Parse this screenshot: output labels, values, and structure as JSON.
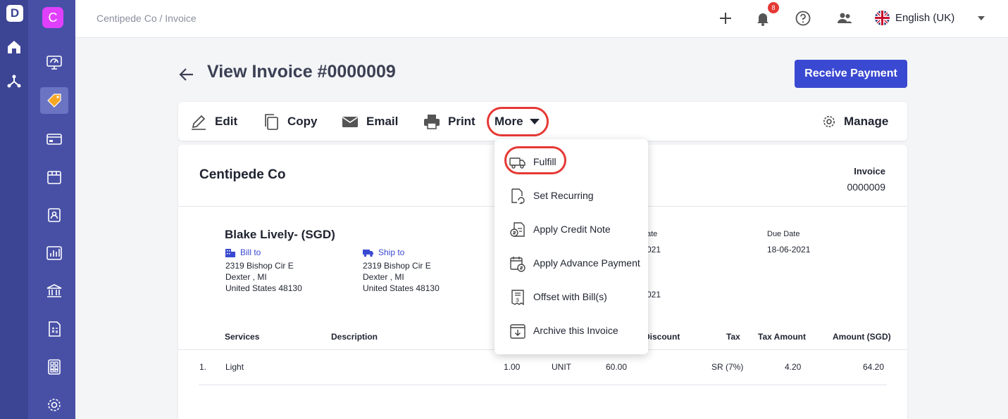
{
  "app": {
    "logo_letter": "D",
    "org_letter": "C"
  },
  "topbar": {
    "breadcrumb": "Centipede Co / Invoice",
    "notification_count": "8",
    "language": "English (UK)"
  },
  "page": {
    "title": "View Invoice #0000009",
    "receive_payment": "Receive Payment"
  },
  "toolbar": {
    "edit": "Edit",
    "copy": "Copy",
    "email": "Email",
    "print": "Print",
    "more": "More",
    "manage": "Manage"
  },
  "menu": {
    "items": [
      {
        "label": "Fulfill",
        "icon": "truck-icon"
      },
      {
        "label": "Set Recurring",
        "icon": "recurring-doc-icon"
      },
      {
        "label": "Apply Credit Note",
        "icon": "credit-note-icon"
      },
      {
        "label": "Apply Advance Payment",
        "icon": "advance-payment-icon"
      },
      {
        "label": "Offset with Bill(s)",
        "icon": "offset-bill-icon"
      },
      {
        "label": "Archive this Invoice",
        "icon": "archive-icon"
      }
    ]
  },
  "invoice": {
    "company": "Centipede Co",
    "label": "Invoice",
    "number": "0000009",
    "customer": "Blake Lively- (SGD)",
    "bill_to": {
      "heading": "Bill to",
      "line1": "2319 Bishop Cir E",
      "line2": "Dexter , MI",
      "line3": "United States 48130"
    },
    "ship_to": {
      "heading": "Ship to",
      "line1": "2319 Bishop Cir E",
      "line2": "Dexter , MI",
      "line3": "United States 48130"
    },
    "invoice_date_label_partial": "ate",
    "invoice_date_partial": "021",
    "extra_date_partial": "021",
    "due_date_label": "Due Date",
    "due_date": "18-06-2021",
    "columns": {
      "services": "Services",
      "description": "Description",
      "discount_partial": "Discount",
      "tax": "Tax",
      "tax_amount": "Tax Amount",
      "amount": "Amount (SGD)"
    },
    "rows": [
      {
        "index": "1.",
        "service": "Light",
        "qty": "1.00",
        "unit": "UNIT",
        "price": "60.00",
        "tax": "SR (7%)",
        "tax_amount": "4.20",
        "amount": "64.20"
      }
    ]
  },
  "colors": {
    "primary": "#3a49d1",
    "rail": "#3c4494",
    "highlight": "#e53935"
  }
}
